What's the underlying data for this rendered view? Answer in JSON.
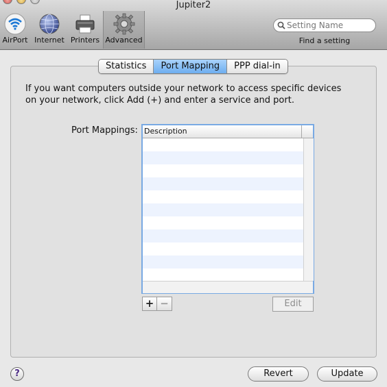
{
  "window": {
    "title": "Jupiter2"
  },
  "toolbar": {
    "items": [
      {
        "label": "AirPort",
        "icon": "airport-wifi-icon"
      },
      {
        "label": "Internet",
        "icon": "internet-globe-icon"
      },
      {
        "label": "Printers",
        "icon": "printer-icon"
      },
      {
        "label": "Advanced",
        "icon": "gear-icon",
        "selected": true
      }
    ],
    "search_placeholder": "Setting Name",
    "search_caption": "Find a setting"
  },
  "tabs": [
    {
      "label": "Statistics",
      "active": false
    },
    {
      "label": "Port Mapping",
      "active": true
    },
    {
      "label": "PPP dial-in",
      "active": false
    }
  ],
  "content": {
    "intro": "If you want computers outside your network to access specific devices on your network, click Add (+) and enter a service and port.",
    "port_mappings_label": "Port Mappings:",
    "table": {
      "columns": [
        "Description"
      ],
      "rows": []
    },
    "add_label": "+",
    "remove_label": "−",
    "edit_label": "Edit"
  },
  "footer": {
    "help_label": "?",
    "revert_label": "Revert",
    "update_label": "Update"
  },
  "colors": {
    "active_tab": "#6eaef0",
    "table_focus_border": "#78a9e3",
    "row_stripe": "#edf3fe"
  }
}
